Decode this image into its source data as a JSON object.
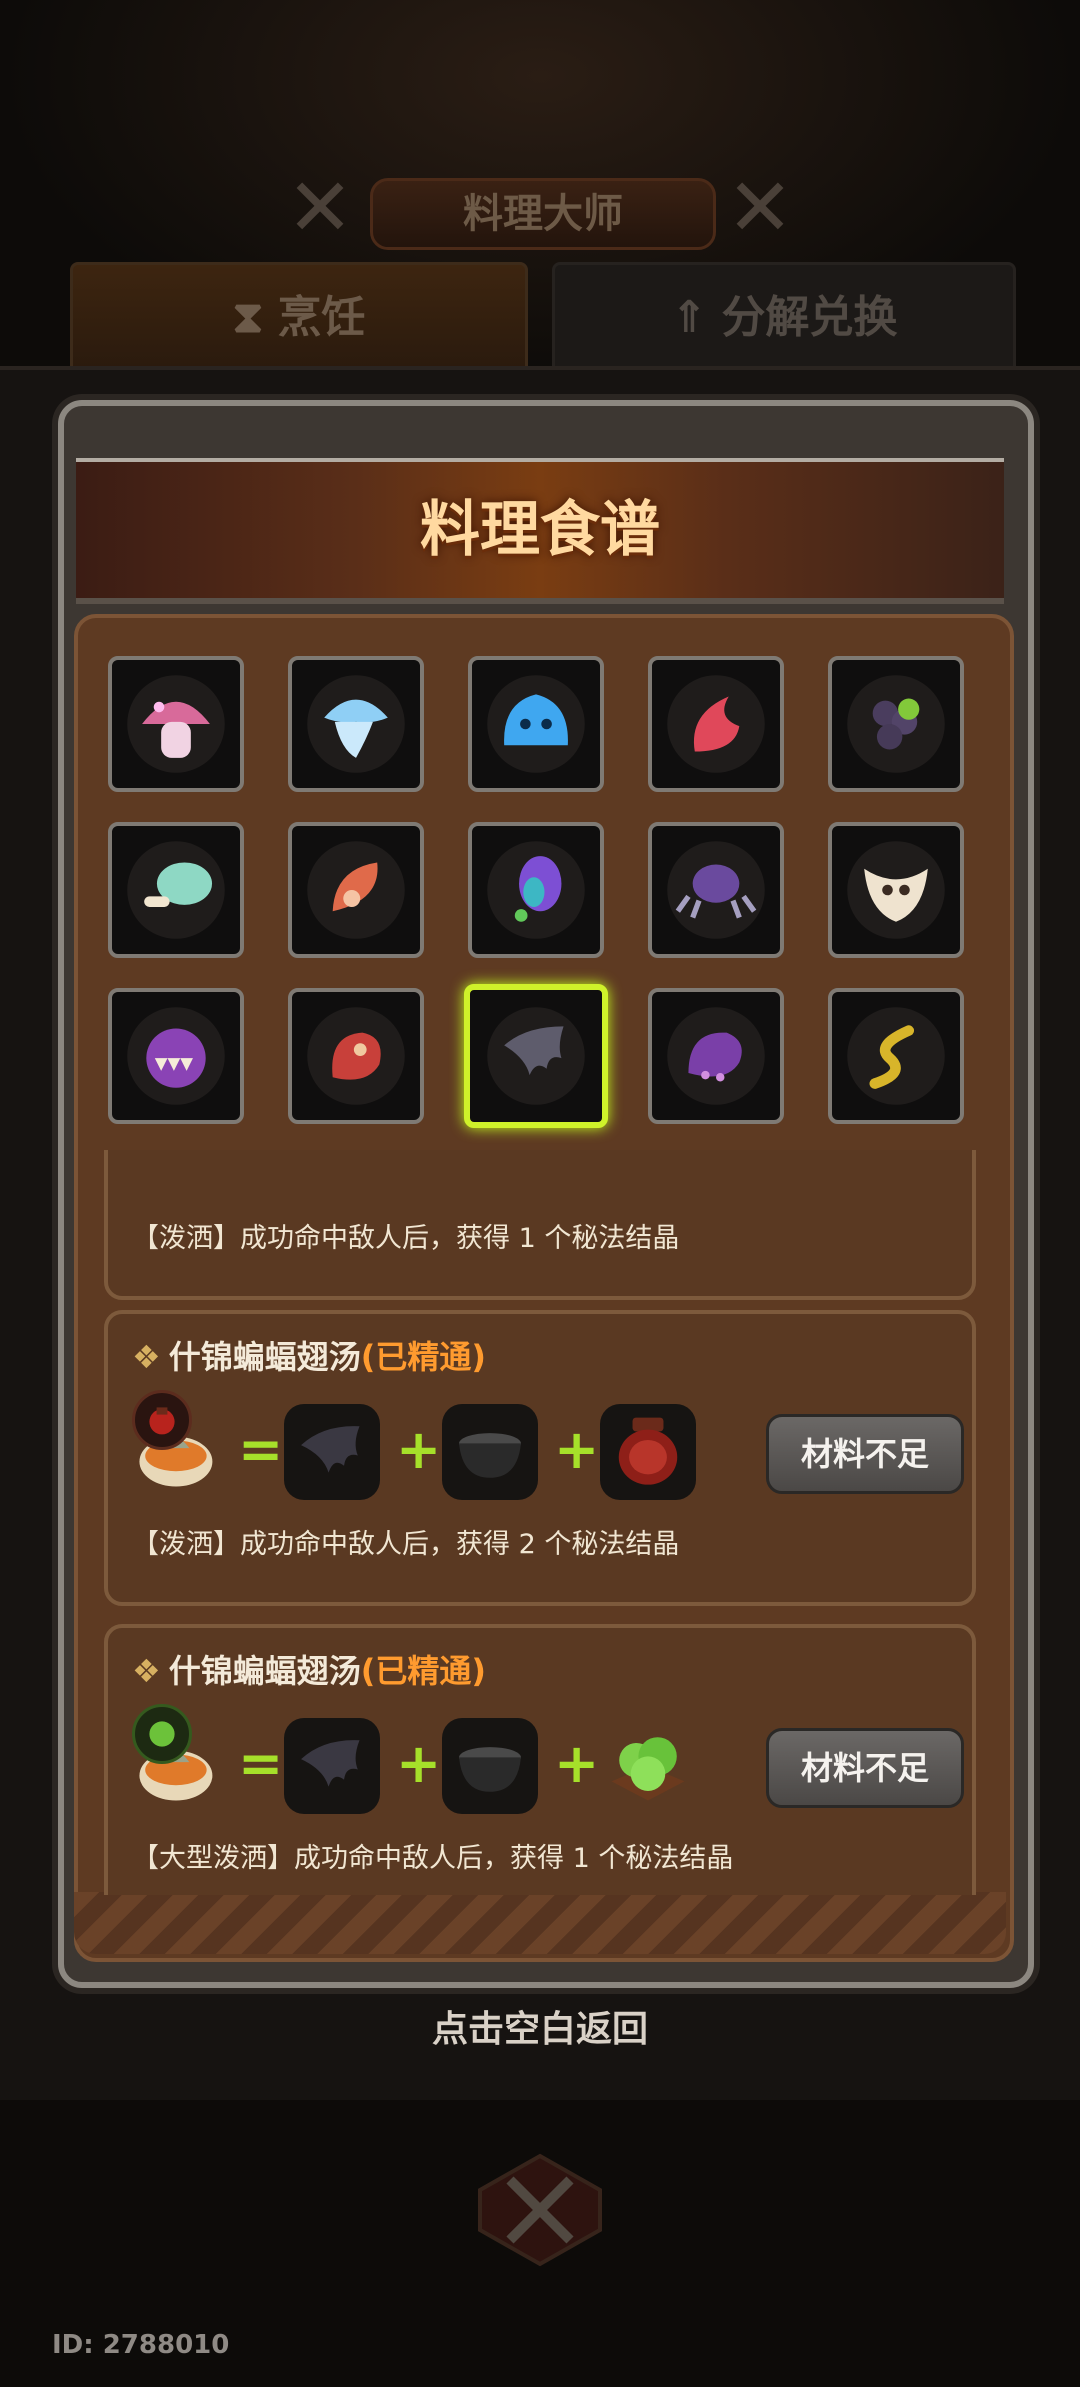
{
  "header": {
    "title": "料理大师",
    "tabs": [
      {
        "label": "烹饪",
        "icon": "hourglass-icon"
      },
      {
        "label": "分解兑换",
        "icon": "up-arrow-icon"
      }
    ]
  },
  "popup": {
    "title": "料理食谱",
    "ingredients": [
      {
        "name": "mushroom-icon"
      },
      {
        "name": "jellyfish-icon"
      },
      {
        "name": "slime-icon"
      },
      {
        "name": "red-flame-icon"
      },
      {
        "name": "grape-cluster-icon"
      },
      {
        "name": "meat-bone-icon"
      },
      {
        "name": "fish-fillet-icon"
      },
      {
        "name": "egg-icon"
      },
      {
        "name": "spider-icon"
      },
      {
        "name": "skull-mask-icon"
      },
      {
        "name": "fang-monster-icon"
      },
      {
        "name": "red-chameleon-icon"
      },
      {
        "name": "bat-wing-icon"
      },
      {
        "name": "tentacle-icon"
      },
      {
        "name": "golden-worm-icon"
      }
    ],
    "selected_index": 12,
    "partial_card": {
      "desc": "【泼洒】成功命中敌人后，获得 1 个秘法结晶"
    },
    "recipes": [
      {
        "title": "什锦蝙蝠翅汤",
        "status": "(已精通)",
        "eq": "=",
        "plus1": "+",
        "plus2": "+",
        "button": "材料不足",
        "desc": "【泼洒】成功命中敌人后，获得 2 个秘法结晶"
      },
      {
        "title": "什锦蝙蝠翅汤",
        "status": "(已精通)",
        "eq": "=",
        "plus1": "+",
        "plus2": "+",
        "button": "材料不足",
        "desc": "【大型泼洒】成功命中敌人后，获得 1 个秘法结晶"
      }
    ]
  },
  "return_hint": "点击空白返回",
  "player_id": "ID: 2788010"
}
